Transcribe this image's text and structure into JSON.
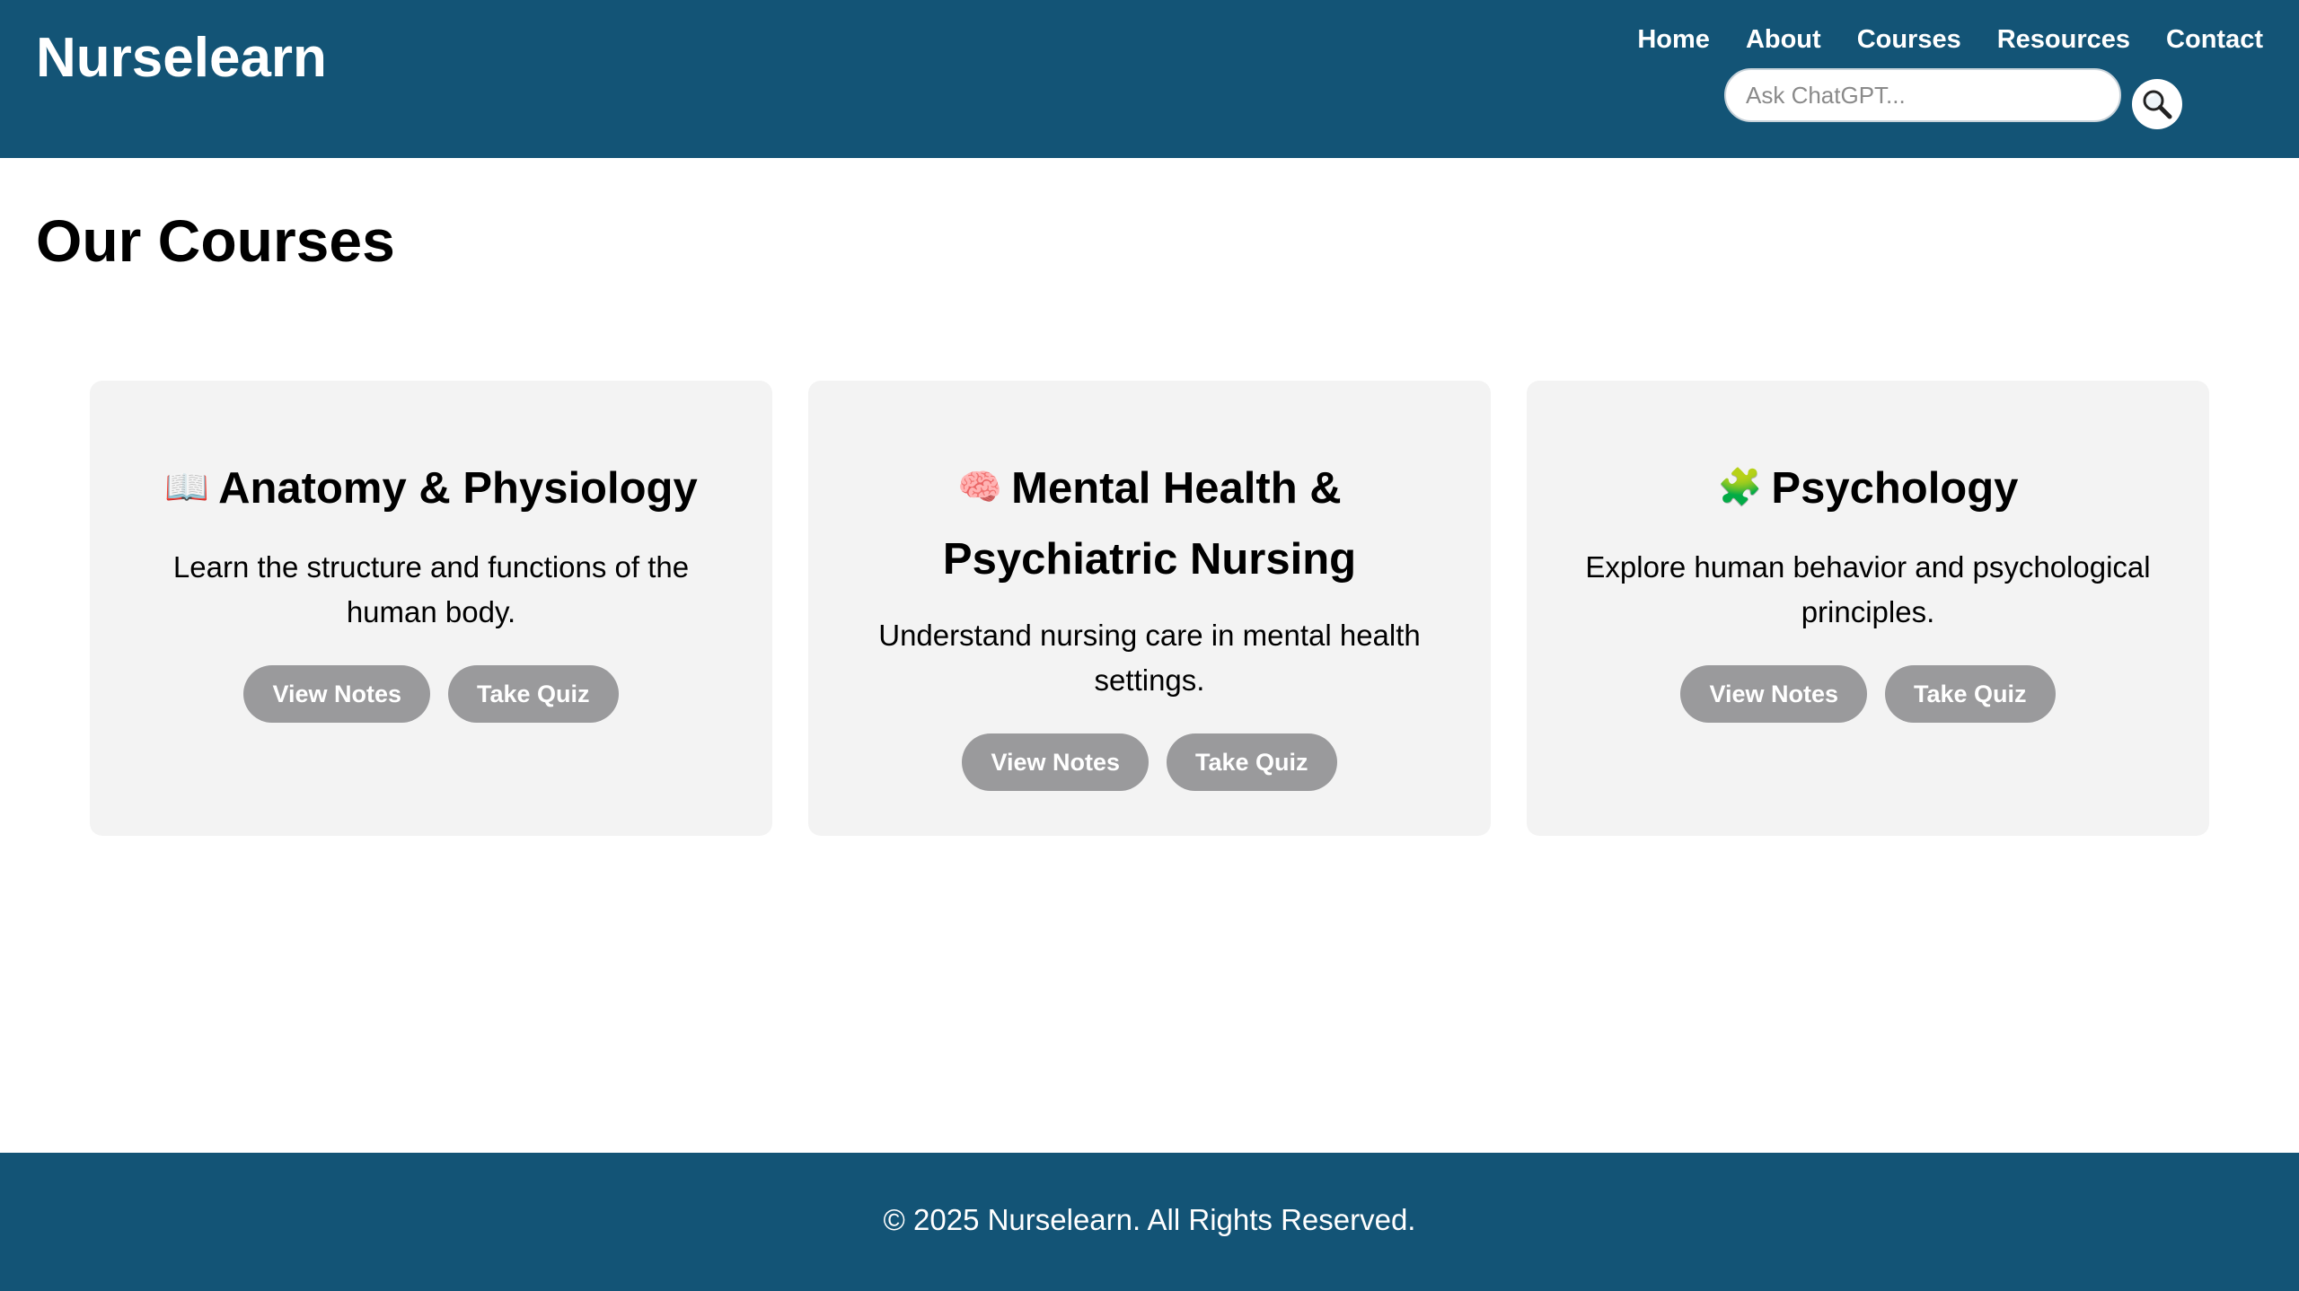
{
  "colors": {
    "header_bg": "#135476",
    "footer_bg": "#135476",
    "card_bg": "#f3f3f3",
    "button_bg": "#9a9a9c",
    "text": "#000000",
    "header_text": "#ffffff"
  },
  "header": {
    "logo": "Nurselearn",
    "nav": [
      {
        "label": "Home"
      },
      {
        "label": "About"
      },
      {
        "label": "Courses"
      },
      {
        "label": "Resources"
      },
      {
        "label": "Contact"
      }
    ],
    "search": {
      "placeholder": "Ask ChatGPT...",
      "value": "",
      "icon": "magnifying-glass-icon"
    }
  },
  "main": {
    "title": "Our Courses",
    "courses": [
      {
        "icon": "📖",
        "icon_name": "open-book-icon",
        "title": "Anatomy & Physiology",
        "description": "Learn the structure and functions of the human body.",
        "view_label": "View Notes",
        "quiz_label": "Take Quiz"
      },
      {
        "icon": "🧠",
        "icon_name": "brain-icon",
        "title": "Mental Health & Psychiatric Nursing",
        "description": "Understand nursing care in mental health settings.",
        "view_label": "View Notes",
        "quiz_label": "Take Quiz"
      },
      {
        "icon": "🧩",
        "icon_name": "puzzle-piece-icon",
        "title": "Psychology",
        "description": "Explore human behavior and psychological principles.",
        "view_label": "View Notes",
        "quiz_label": "Take Quiz"
      }
    ]
  },
  "footer": {
    "text": "© 2025 Nurselearn. All Rights Reserved."
  }
}
